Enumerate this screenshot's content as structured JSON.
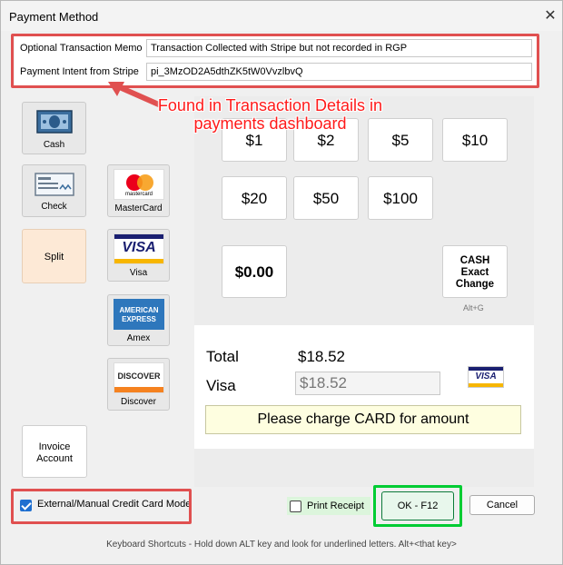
{
  "window": {
    "title": "Payment Method",
    "close_glyph": "✕"
  },
  "memo": {
    "memo_label": "Optional Transaction Memo",
    "memo_value": "Transaction Collected with Stripe but not recorded in RGP",
    "intent_label": "Payment Intent from Stripe",
    "intent_value": "pi_3MzOD2A5dthZK5tW0VvzlbvQ"
  },
  "annotation": {
    "text": "Found in Transaction Details in payments dashboard",
    "color": "#ff1a1a"
  },
  "left_tiles": {
    "cash": "Cash",
    "check": "Check",
    "mastercard": "MasterCard",
    "split": "Split",
    "visa": "Visa",
    "amex": "Amex",
    "discover": "Discover",
    "invoice": "Invoice Account"
  },
  "logos": {
    "mastercard": "mastercard",
    "visa": "VISA",
    "amex_top": "AMERICAN",
    "amex_bottom": "EXPRESS",
    "discover": "DISCOVER"
  },
  "amounts": {
    "a1": "$1",
    "a2": "$2",
    "a5": "$5",
    "a10": "$10",
    "a20": "$20",
    "a50": "$50",
    "a100": "$100",
    "zero": "$0.00"
  },
  "cash_exact": {
    "line1": "CASH",
    "line2": "Exact",
    "line3": "Change",
    "shortcut": "Alt+G"
  },
  "totals": {
    "total_label": "Total",
    "total_value": "$18.52",
    "visa_label": "Visa",
    "visa_value": "$18.52"
  },
  "charge_message": "Please charge CARD for amount",
  "footer": {
    "manual_mode_label": "External/Manual Credit Card Mode",
    "manual_mode_checked": true,
    "print_receipt_label": "Print Receipt",
    "print_receipt_checked": false,
    "ok_label": "OK - F12",
    "cancel_label": "Cancel",
    "shortcuts_text": "Keyboard Shortcuts - Hold down ALT key and look for underlined letters.   Alt+<that key>"
  },
  "colors": {
    "highlight_red": "#e05050",
    "highlight_green": "#00cc33",
    "accent_blue": "#1e6fd0"
  }
}
